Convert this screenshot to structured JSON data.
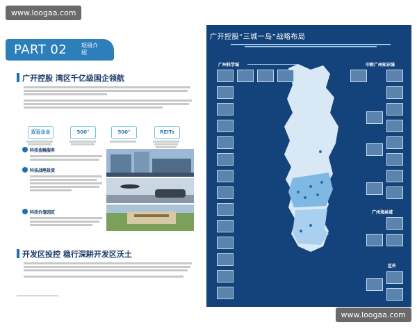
{
  "watermark": {
    "top": "www.loogaa.com",
    "bottom": "www.loogaa.com"
  },
  "left": {
    "part": "PART 02",
    "part_sub": "项目介绍",
    "section1_title": "广开控股 湾区千亿级国企领航",
    "section2_title": "开发区投控 稳行深耕开发区沃土",
    "stats": [
      {
        "value": "双百企业"
      },
      {
        "value": "500°"
      },
      {
        "value": "500°"
      },
      {
        "value": "REITs"
      }
    ],
    "subsections": [
      {
        "title": "科技金融服务"
      },
      {
        "title": "科技战略投资"
      },
      {
        "title": "科技价值园区"
      }
    ]
  },
  "right": {
    "title": "广开控股“三城一岛”战略布局",
    "zones": [
      {
        "label": "广州科学城"
      },
      {
        "label": "中新广州知识城"
      },
      {
        "label": "广州海丝城"
      },
      {
        "label": "区外"
      }
    ]
  },
  "colors": {
    "accent": "#2d7fbc",
    "dark_blue": "#14427a",
    "map_land": "#d9e8f5"
  }
}
